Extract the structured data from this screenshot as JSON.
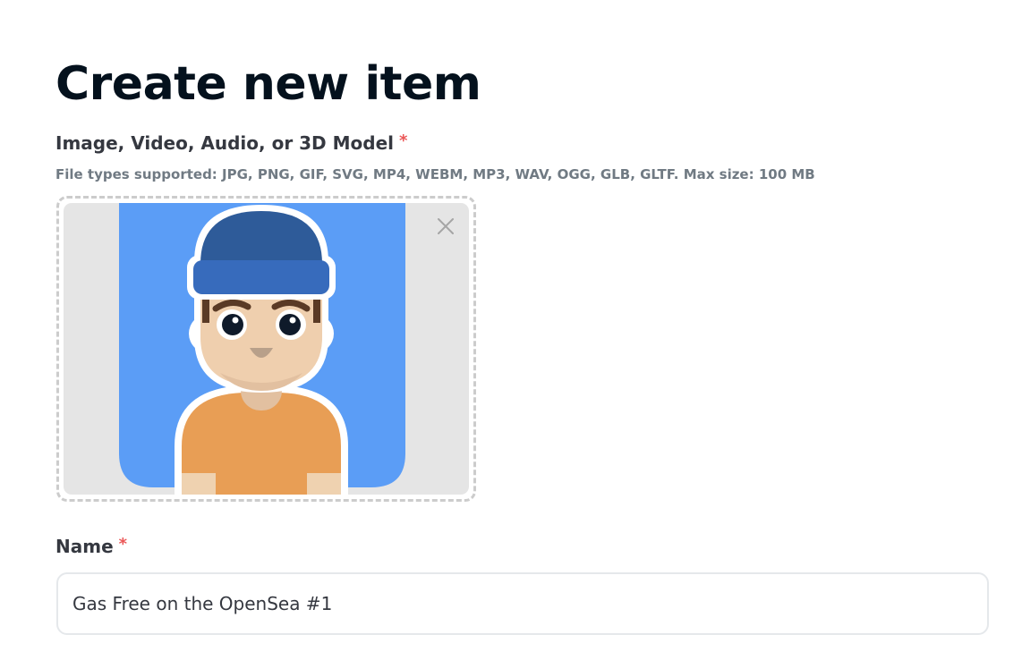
{
  "page": {
    "title": "Create new item"
  },
  "media_field": {
    "label": "Image, Video, Audio, or 3D Model",
    "required_mark": "*",
    "hint": "File types supported: JPG, PNG, GIF, SVG, MP4, WEBM, MP3, WAV, OGG, GLB, GLTF. Max size: 100 MB",
    "preview_icon": "avatar-beanie-illustration",
    "remove_icon": "close-icon"
  },
  "name_field": {
    "label": "Name",
    "required_mark": "*",
    "value": "Gas Free on the OpenSea #1"
  },
  "colors": {
    "required": "#eb5757",
    "avatar_background": "#5b9df6",
    "beanie": "#2e5b99",
    "shirt": "#e89e55"
  }
}
